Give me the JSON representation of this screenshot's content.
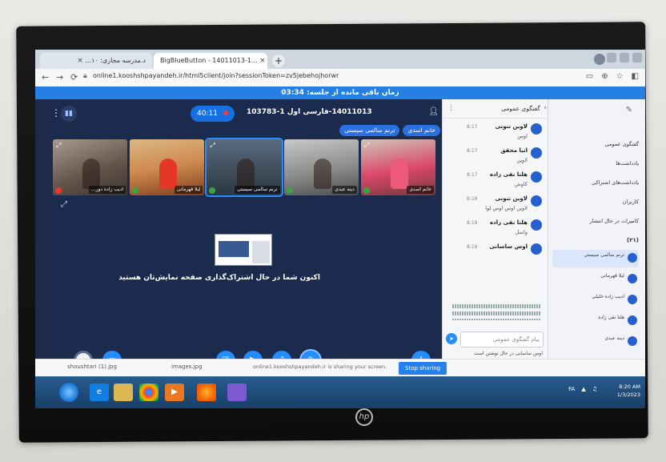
{
  "browser": {
    "tabs": [
      {
        "label": "د.مدرسه مجازی: ۱۰..."
      },
      {
        "label": "BigBlueButton - 14011013-1..."
      }
    ],
    "url": "online1.kooshshpayandeh.ir/html5client/join?sessionToken=zv5jebehojhorwr",
    "close_glyph": "×",
    "new_tab_glyph": "+"
  },
  "banner": {
    "text": "زمان باقی مانده از جلسه: 03:34"
  },
  "meeting": {
    "title": "14011013-فارسی اول 1-103783",
    "rec_timer": "40:11",
    "talkers": [
      "خانم اسدی",
      "ترنم سالمی سیستی"
    ]
  },
  "videos": [
    {
      "name": "ادیب زاده دور..."
    },
    {
      "name": "لیلا قهرمانی"
    },
    {
      "name": "ترنم سالمی سیستی"
    },
    {
      "name": "دینه عبدی"
    },
    {
      "name": "خانم اسدی"
    }
  ],
  "screenshare": {
    "text": "اکنون شما در حال اشتراک‌گذاری صفحه نمایش‌تان هستید"
  },
  "chat": {
    "title": "گفتگوی عمومی",
    "messages": [
      {
        "name": "لاوین تنونی",
        "time": "8:17",
        "text": "اوس"
      },
      {
        "name": "انیا محقق",
        "time": "8:17",
        "text": "لاوین"
      },
      {
        "name": "هلنا نقی زاده",
        "time": "8:17",
        "text": "کاوش"
      },
      {
        "name": "لاوین تنونی",
        "time": "8:18",
        "text": "لاوین اوس اوس لوا"
      },
      {
        "name": "هلنا نقی زاده",
        "time": "8:18",
        "text": "واسل"
      },
      {
        "name": "اوس ساسانی",
        "time": "8:18",
        "text": ""
      }
    ],
    "input_placeholder": "پیام گفتگوی عمومی",
    "typing": "اوس ساسانی در حال نوشتن است"
  },
  "userlist": {
    "items": [
      "گفتگوی عمومی",
      "یادداشت‌ها",
      "یادداشت‌های اشتراکی",
      "کاربران",
      "کامیرات در حال انتشار"
    ],
    "section": "(۲۱)",
    "users": [
      "ترنم سالمی سیستی",
      "لیلا قهرمانی",
      "ادیب زاده خلیلی",
      "هلنا نقی زاده",
      "دینه عبدی"
    ]
  },
  "downloads": {
    "items": [
      "shoushtari (1).jpg",
      "images.jpg"
    ],
    "sharing_notice": "online1.kooshshpayandeh.ir is sharing your screen.",
    "stop_label": "Stop sharing"
  },
  "taskbar": {
    "time": "8:20 AM",
    "date": "1/3/2023",
    "lang": "FA"
  },
  "icons": {
    "back": "back-arrow-icon",
    "forward": "forward-arrow-icon",
    "reload": "reload-icon",
    "mic": "microphone-icon"
  }
}
